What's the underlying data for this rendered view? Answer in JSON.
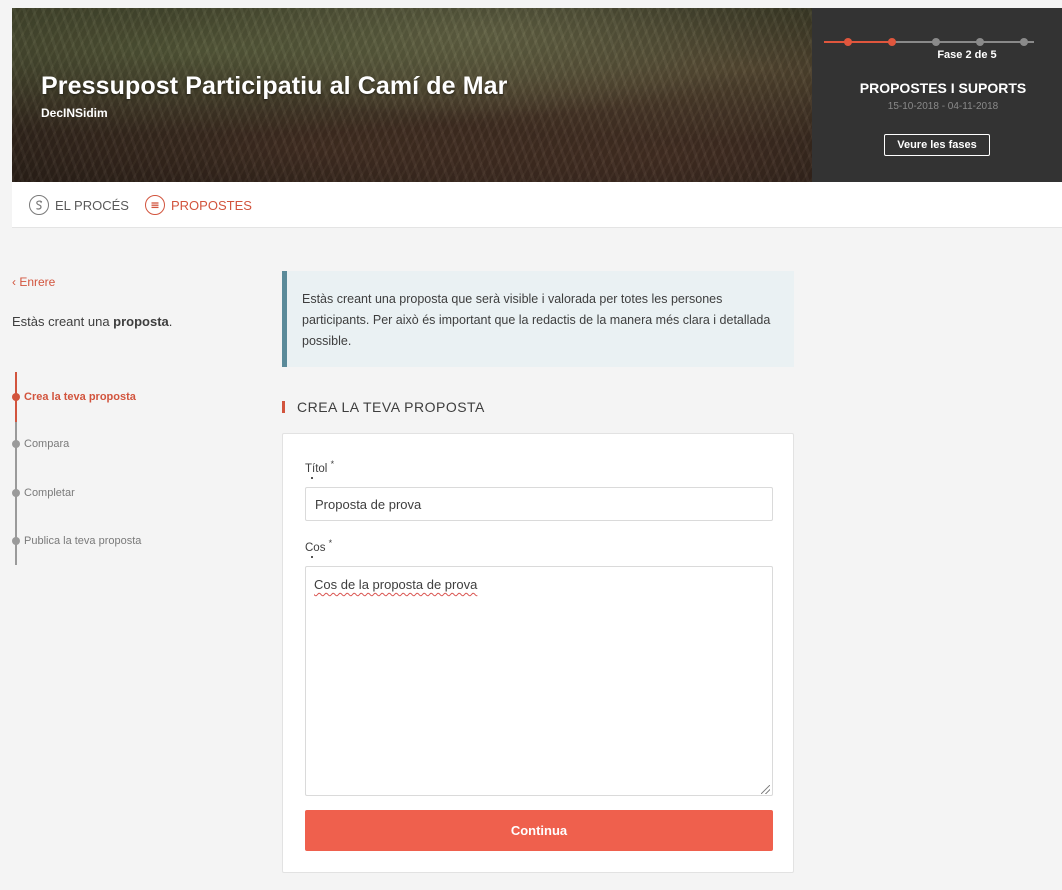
{
  "hero": {
    "title": "Pressupost Participatiu al Camí de Mar",
    "organization": "DecINSidim"
  },
  "phase": {
    "label": "Fase 2 de 5",
    "current": 2,
    "total": 5,
    "name": "PROPOSTES I SUPORTS",
    "dates": "15-10-2018 - 04-11-2018",
    "button_label": "Veure les fases"
  },
  "process_nav": {
    "items": [
      {
        "label": "EL PROCÉS",
        "icon": "process-icon",
        "active": false
      },
      {
        "label": "PROPOSTES",
        "icon": "proposals-icon",
        "active": true
      }
    ]
  },
  "sidebar": {
    "back_label": "‹ Enrere",
    "intro_prefix": "Estàs creant una ",
    "intro_bold": "proposta",
    "intro_suffix": ".",
    "steps": [
      {
        "label": "Crea la teva proposta",
        "active": true
      },
      {
        "label": "Compara",
        "active": false
      },
      {
        "label": "Completar",
        "active": false
      },
      {
        "label": "Publica la teva proposta",
        "active": false
      }
    ]
  },
  "callout": {
    "text": "Estàs creant una proposta que serà visible i valorada per totes les persones participants. Per això és important que la redactis de la manera més clara i detallada possible."
  },
  "form": {
    "section_title": "CREA LA TEVA PROPOSTA",
    "title_label": "Títol",
    "title_value": "Proposta de prova",
    "body_label": "Cos",
    "body_value": "Cos de la proposta de prova",
    "required_mark": "*",
    "submit_label": "Continua"
  },
  "colors": {
    "accent": "#d2543d",
    "button": "#ef604d",
    "callout_bg": "#eaf1f3",
    "callout_border": "#5a8a99",
    "phase_panel": "#333333"
  }
}
